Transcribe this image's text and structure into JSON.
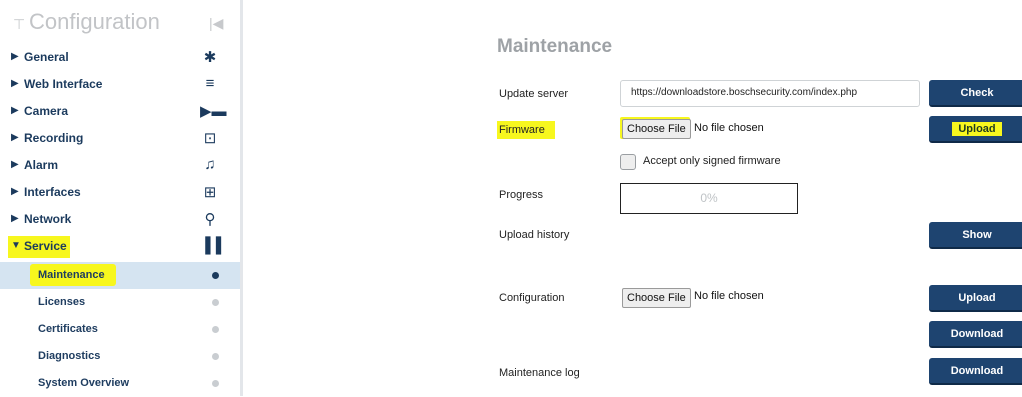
{
  "sidebar": {
    "title": "Configuration",
    "items": [
      {
        "label": "General",
        "icon": "gear-icon"
      },
      {
        "label": "Web Interface",
        "icon": "menu-icon"
      },
      {
        "label": "Camera",
        "icon": "camera-icon"
      },
      {
        "label": "Recording",
        "icon": "recording-icon"
      },
      {
        "label": "Alarm",
        "icon": "bell-icon"
      },
      {
        "label": "Interfaces",
        "icon": "interfaces-icon"
      },
      {
        "label": "Network",
        "icon": "network-icon"
      },
      {
        "label": "Service",
        "icon": "bar-chart-icon",
        "expanded": true
      }
    ],
    "service_subitems": [
      {
        "label": "Maintenance",
        "active": true
      },
      {
        "label": "Licenses"
      },
      {
        "label": "Certificates"
      },
      {
        "label": "Diagnostics"
      },
      {
        "label": "System Overview"
      }
    ]
  },
  "main": {
    "title": "Maintenance",
    "update_server": {
      "label": "Update server",
      "value": "https://downloadstore.boschsecurity.com/index.php",
      "button": "Check"
    },
    "firmware": {
      "label": "Firmware",
      "choose": "Choose File",
      "nofile": "No file chosen",
      "button": "Upload"
    },
    "signed": {
      "label": "Accept only signed firmware",
      "checked": false
    },
    "progress": {
      "label": "Progress",
      "value": "0%"
    },
    "upload_history": {
      "label": "Upload history",
      "button": "Show"
    },
    "configuration": {
      "label": "Configuration",
      "choose": "Choose File",
      "nofile": "No file chosen",
      "upload_button": "Upload",
      "download_button": "Download"
    },
    "maintenance_log": {
      "label": "Maintenance log",
      "button": "Download"
    }
  },
  "colors": {
    "accent": "#1e4470",
    "highlight": "#f7f71e",
    "active_bg": "#d5e4f1"
  }
}
